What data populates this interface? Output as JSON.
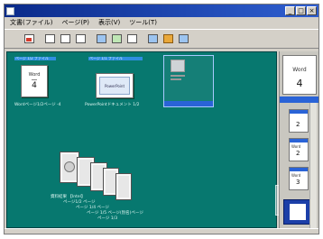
{
  "window": {
    "title": "",
    "buttons": [
      "_",
      "□",
      "×"
    ]
  },
  "menu": [
    "文書(ファイル)",
    "ページ(P)",
    "表示(V)",
    "ツール(T)"
  ],
  "toolbar": {
    "buttons": [
      {
        "icon": "open-icon"
      },
      {
        "icon": "pages-icon"
      },
      {
        "icon": "link-icon"
      },
      {
        "icon": "print-icon"
      },
      {
        "icon": "copy-icon"
      },
      {
        "icon": "paste-icon"
      },
      {
        "icon": "picture-icon"
      },
      {
        "icon": "grid-icon"
      },
      {
        "icon": "folder-icon"
      },
      {
        "icon": "settings-icon"
      }
    ]
  },
  "canvas": {
    "docs": [
      {
        "header": "ページ 1/2  ファイル",
        "card_title": "Word",
        "card_number": "4",
        "label": "Wordページ1/2ページ -4"
      },
      {
        "header": "ページ 1/1  ファイル",
        "card_title": "PowerPoint",
        "label": "PowerPointドキュメント 1/2"
      },
      {
        "header": "",
        "label": ""
      }
    ],
    "fan": {
      "lines": [
        "資料結果 【Intel】",
        "ページ1/2 ページ",
        "ページ 1/4 ページ",
        "ページ 1/5 ページ(別名)ページ",
        "ページ 1/3"
      ]
    }
  },
  "panel": {
    "top_card": {
      "title": "Word",
      "number": "4"
    },
    "items": [
      {
        "title": "",
        "number": "2"
      },
      {
        "title": "Word",
        "number": "2"
      },
      {
        "title": "Word",
        "number": "3"
      }
    ]
  }
}
